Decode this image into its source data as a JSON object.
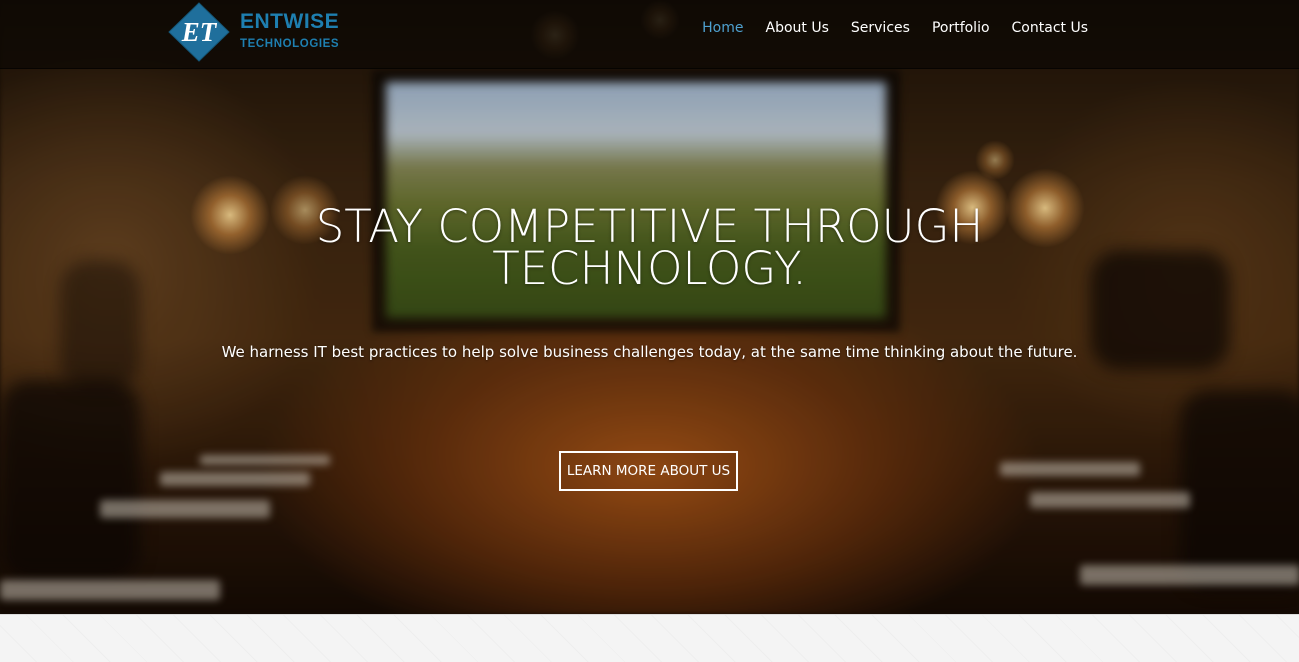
{
  "brand": {
    "logo_mark_text": "ET",
    "name": "ENTWISE",
    "tagline": "TECHNOLOGIES",
    "color": "#1e7fb0"
  },
  "nav": {
    "items": [
      {
        "label": "Home",
        "active": true
      },
      {
        "label": "About Us",
        "active": false
      },
      {
        "label": "Services",
        "active": false
      },
      {
        "label": "Portfolio",
        "active": false
      },
      {
        "label": "Contact Us",
        "active": false
      }
    ],
    "active_color": "#4ea0cf"
  },
  "hero": {
    "title_line1": "STAY COMPETITIVE THROUGH",
    "title_line2": "TECHNOLOGY.",
    "subtitle": "We harness IT best practices to help solve business challenges today, at the same time thinking about the future.",
    "cta_label": "LEARN MORE ABOUT US",
    "background": "blurred conference room photo"
  }
}
